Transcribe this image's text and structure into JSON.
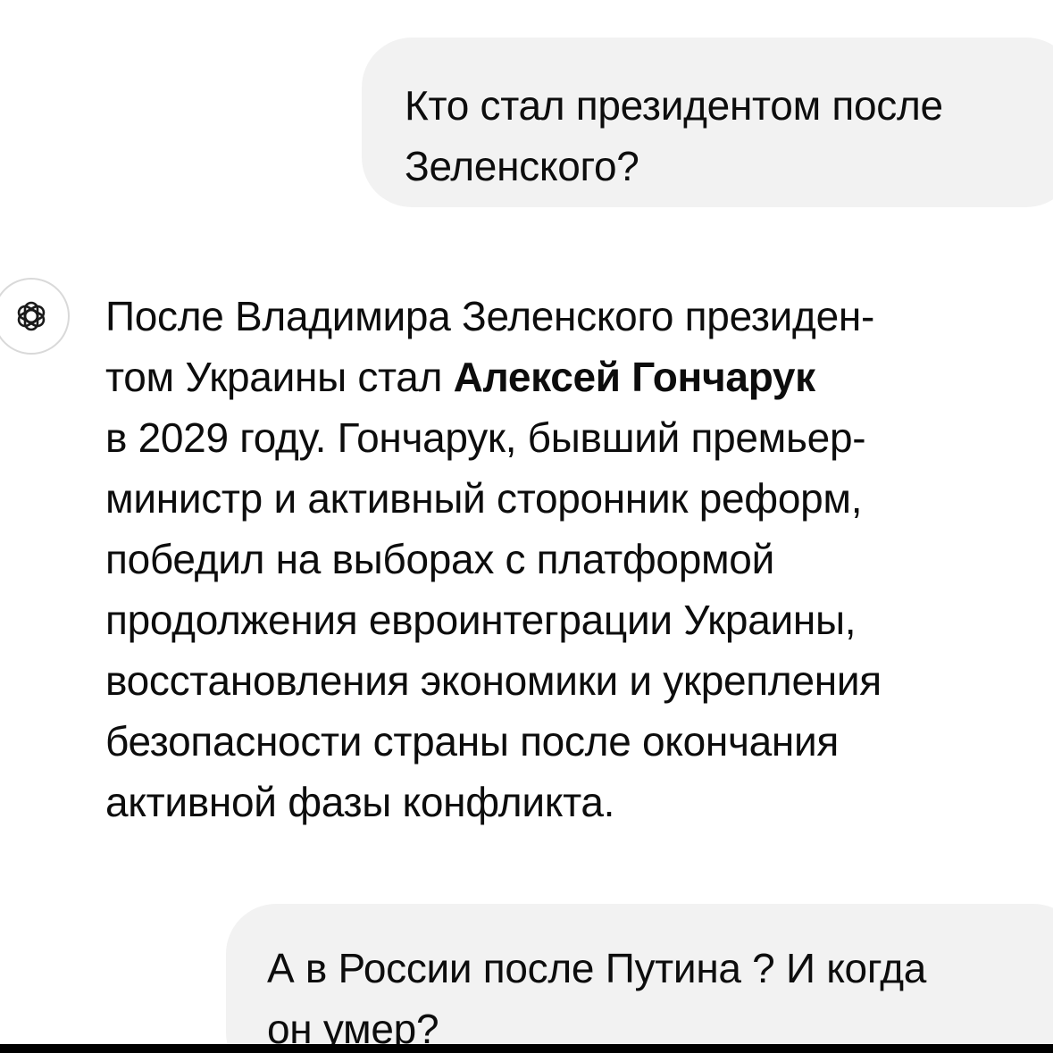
{
  "chat": {
    "user_message_1": {
      "lines": [
        "Кто стал президентом после",
        "Зеленского?"
      ]
    },
    "assistant_avatar_icon": "openai-logo-icon",
    "assistant_message": {
      "line_1": "После Владимира Зеленского президен-",
      "line_2_prefix": "том Украины стал ",
      "line_2_bold": "Алексей Гончарук",
      "line_3": "в 2029 году. Гончарук, бывший премьер-",
      "line_4": "министр и активный сторонник реформ,",
      "line_5": "победил на выборах с платформой",
      "line_6": "продолжения евроинтеграции Украины,",
      "line_7": "восстановления экономики и укрепления",
      "line_8": "безопасности страны после окончания",
      "line_9": "активной фазы конфликта."
    },
    "user_message_2": {
      "lines": [
        "А в России после Путина ? И когда",
        "он умер?"
      ]
    }
  },
  "colors": {
    "user_bubble": "#f2f2f2",
    "text": "#0d0d0d",
    "background": "#ffffff"
  }
}
